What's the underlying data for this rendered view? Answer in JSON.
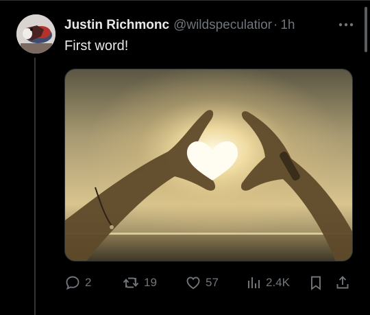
{
  "tweet": {
    "display_name": "Justin Richmonc",
    "handle": "@wildspeculatior",
    "separator": "·",
    "time": "1h",
    "text": "First word!"
  },
  "actions": {
    "replies": "2",
    "reposts": "19",
    "likes": "57",
    "views": "2.4K"
  },
  "colors": {
    "background": "#000000",
    "text_primary": "#e7e9ea",
    "text_secondary": "#71767b",
    "divider": "#2f3336"
  },
  "icons": [
    "more-icon",
    "reply-icon",
    "repost-icon",
    "like-icon",
    "views-icon",
    "bookmark-icon",
    "share-icon"
  ]
}
